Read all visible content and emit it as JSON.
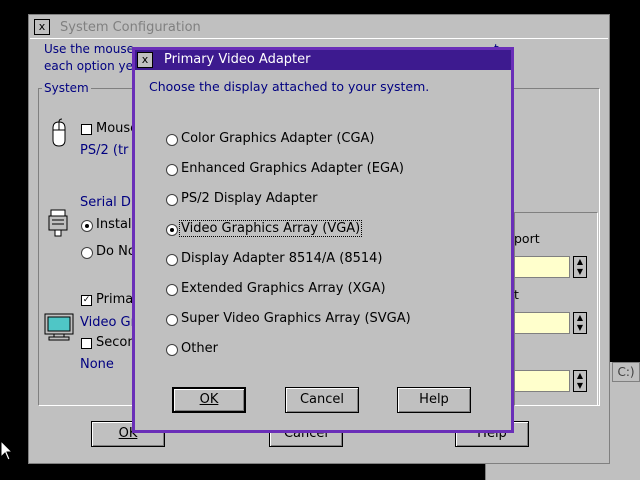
{
  "background_window": {
    "title": "System Configuration",
    "system_menu_glyph": "x",
    "instructions_line1": "Use the mouse",
    "instructions_line1_tail": "t",
    "instructions_line2": "each option ye",
    "system_group_label": "System",
    "mouse_label": "Mouse",
    "mouse_value": "PS/2 (tr",
    "serial_label": "Serial D",
    "install_label": "Instal",
    "donot_label": "Do No",
    "primary_label": "Prima",
    "video_value": "Video Gr",
    "secondary_label": "Secon",
    "secondary_value": "None",
    "port_label": "port",
    "t_label": "t",
    "ok_label": "OK",
    "cancel_label": "Cancel",
    "help_label": "Help",
    "drive_label": "C:)"
  },
  "dialog": {
    "title": "Primary Video Adapter",
    "system_menu_glyph": "x",
    "prompt": "Choose the display attached to your system.",
    "options": [
      {
        "label": "Color Graphics Adapter (CGA)",
        "selected": false
      },
      {
        "label": "Enhanced Graphics Adapter (EGA)",
        "selected": false
      },
      {
        "label": "PS/2 Display Adapter",
        "selected": false
      },
      {
        "label": "Video Graphics Array (VGA)",
        "selected": true
      },
      {
        "label": "Display Adapter 8514/A (8514)",
        "selected": false
      },
      {
        "label": "Extended Graphics Array (XGA)",
        "selected": false
      },
      {
        "label": "Super Video Graphics Array (SVGA)",
        "selected": false
      },
      {
        "label": "Other",
        "selected": false
      }
    ],
    "ok_label": "OK",
    "cancel_label": "Cancel",
    "help_label": "Help"
  },
  "colors": {
    "desktop": "#000000",
    "dialog_border": "#6a2eb8",
    "dialog_titlebar": "#3d1a8f",
    "navy_text": "#000080",
    "window_face": "#c0c0c0"
  }
}
